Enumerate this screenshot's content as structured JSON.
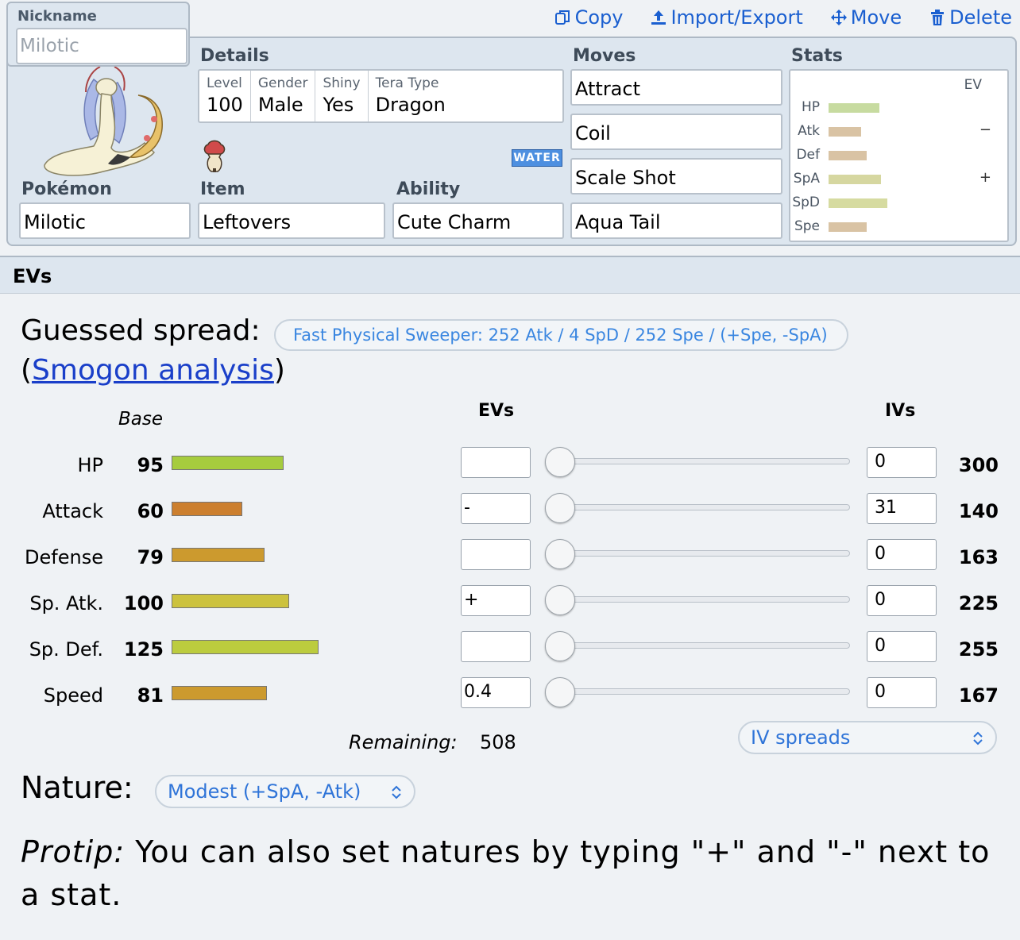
{
  "toolbar": {
    "copy": "Copy",
    "import_export": "Import/Export",
    "move": "Move",
    "delete": "Delete"
  },
  "nickname": {
    "label": "Nickname",
    "placeholder": "Milotic"
  },
  "labels": {
    "details": "Details",
    "moves": "Moves",
    "stats": "Stats",
    "pokemon": "Pokémon",
    "item": "Item",
    "ability": "Ability"
  },
  "details": {
    "level_label": "Level",
    "level": "100",
    "gender_label": "Gender",
    "gender": "Male",
    "shiny_label": "Shiny",
    "shiny": "Yes",
    "tera_label": "Tera Type",
    "tera": "Dragon"
  },
  "type_badge": "WATER",
  "pokemon": "Milotic",
  "item": "Leftovers",
  "ability": "Cute Charm",
  "moves": [
    "Attract",
    "Coil",
    "Scale Shot",
    "Aqua Tail"
  ],
  "stats_panel": {
    "ev_header": "EV",
    "rows": [
      {
        "name": "HP",
        "fill": 0.25,
        "color": "#c7dba0",
        "mark": ""
      },
      {
        "name": "Atk",
        "fill": 0.16,
        "color": "#d9c3a4",
        "mark": "−"
      },
      {
        "name": "Def",
        "fill": 0.19,
        "color": "#d9c3a4",
        "mark": ""
      },
      {
        "name": "SpA",
        "fill": 0.26,
        "color": "#d6d7a0",
        "mark": "+"
      },
      {
        "name": "SpD",
        "fill": 0.29,
        "color": "#d6dba0",
        "mark": ""
      },
      {
        "name": "Spe",
        "fill": 0.19,
        "color": "#d9c3a4",
        "mark": ""
      }
    ]
  },
  "evs_section": {
    "header": "EVs",
    "guessed_label": "Guessed spread:",
    "guessed_spread": "Fast Physical Sweeper: 252 Atk / 4 SpD / 252 Spe / (+Spe, -SpA)",
    "smogon_open": "(",
    "smogon_link": "Smogon analysis",
    "smogon_close": ")",
    "base_header": "Base",
    "evs_header": "EVs",
    "ivs_header": "IVs",
    "rows": [
      {
        "name": "HP",
        "base": "95",
        "base_value": 95,
        "color": "#a6cc3e",
        "ev": "",
        "iv": "0",
        "total": "300"
      },
      {
        "name": "Attack",
        "base": "60",
        "base_value": 60,
        "color": "#cc7f2e",
        "ev": "-",
        "iv": "31",
        "total": "140"
      },
      {
        "name": "Defense",
        "base": "79",
        "base_value": 79,
        "color": "#cc9a2e",
        "ev": "",
        "iv": "0",
        "total": "163"
      },
      {
        "name": "Sp. Atk.",
        "base": "100",
        "base_value": 100,
        "color": "#ccc23e",
        "ev": "+",
        "iv": "0",
        "total": "225"
      },
      {
        "name": "Sp. Def.",
        "base": "125",
        "base_value": 125,
        "color": "#bccc3e",
        "ev": "",
        "iv": "0",
        "total": "255"
      },
      {
        "name": "Speed",
        "base": "81",
        "base_value": 81,
        "color": "#cc9a2e",
        "ev": "0.4",
        "iv": "0",
        "total": "167"
      }
    ],
    "remaining_label": "Remaining:",
    "remaining": "508",
    "iv_spreads": "IV spreads",
    "nature_label": "Nature:",
    "nature": "Modest (+SpA, -Atk)",
    "protip_label": "Protip:",
    "protip_text": " You can also set natures by typing \"+\" and \"-\" next to a stat."
  },
  "colors": {
    "accent": "#1a5fd0",
    "link": "#1a3fc9",
    "panel": "#dde6ef"
  }
}
